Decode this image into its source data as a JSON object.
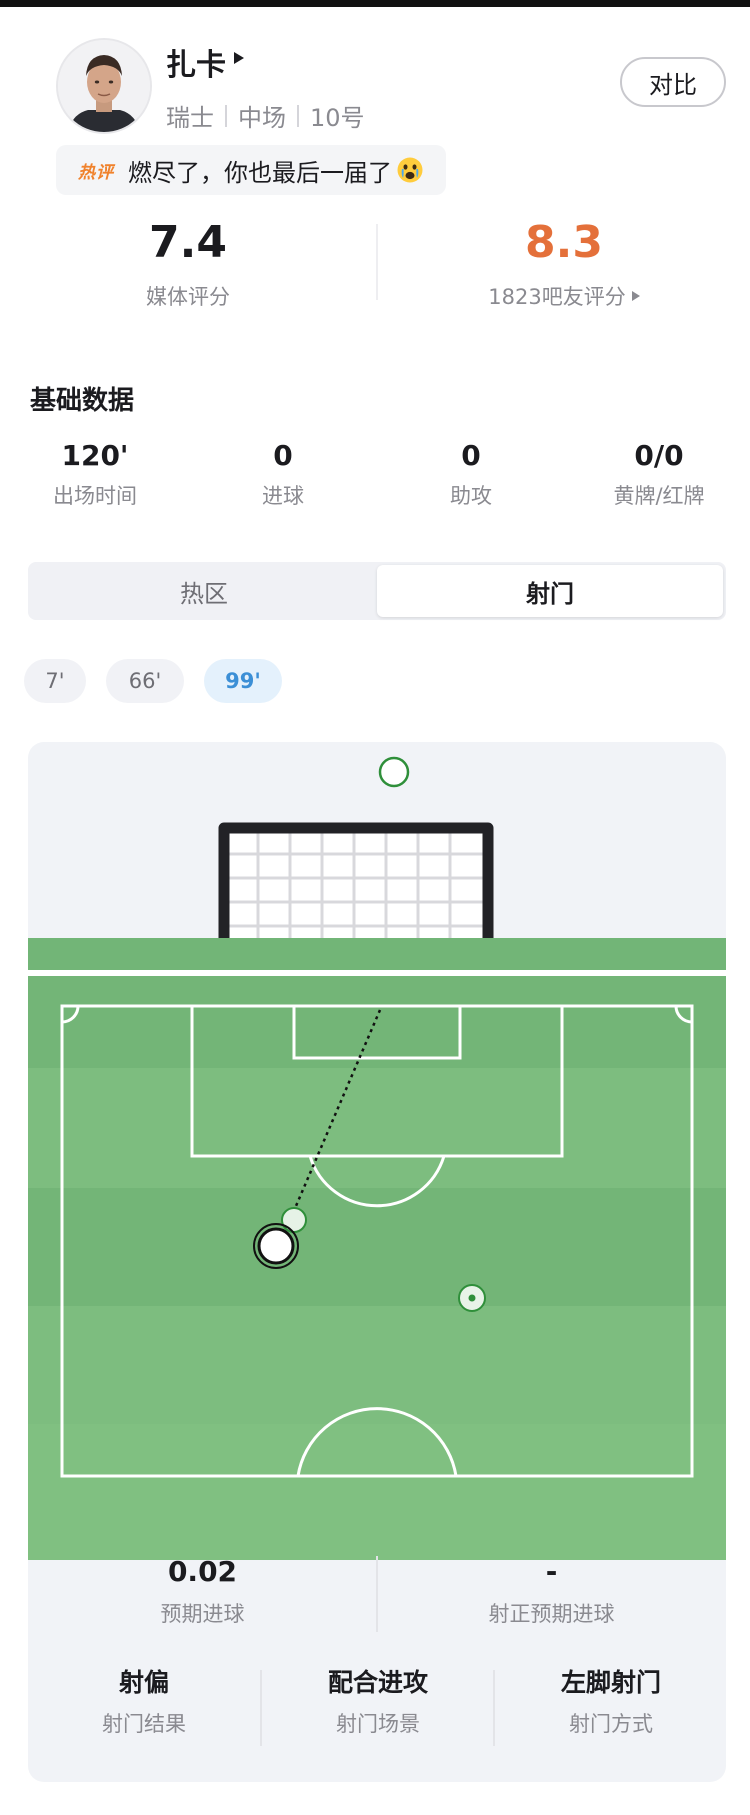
{
  "player": {
    "name": "扎卡",
    "country": "瑞士",
    "position": "中场",
    "number": "10号"
  },
  "compare_label": "对比",
  "hot_comment": {
    "tag": "热评",
    "text": "燃尽了，你也最后一届了"
  },
  "ratings": {
    "media_value": "7.4",
    "media_label": "媒体评分",
    "fan_value": "8.3",
    "fan_label": "1823吧友评分",
    "fan_color": "#e4703a"
  },
  "basic_stats": {
    "title": "基础数据",
    "items": [
      {
        "value": "120'",
        "label": "出场时间"
      },
      {
        "value": "0",
        "label": "进球"
      },
      {
        "value": "0",
        "label": "助攻"
      },
      {
        "value": "0/0",
        "label": "黄牌/红牌"
      }
    ]
  },
  "tabs": [
    {
      "label": "热区",
      "active": false
    },
    {
      "label": "射门",
      "active": true
    }
  ],
  "minute_chips": [
    {
      "label": "7'",
      "active": false
    },
    {
      "label": "66'",
      "active": false
    },
    {
      "label": "99'",
      "active": true
    }
  ],
  "shot_summary": {
    "xg_value": "0.02",
    "xg_label": "预期进球",
    "xgot_value": "-",
    "xgot_label": "射正预期进球",
    "details": [
      {
        "value": "射偏",
        "label": "射门结果"
      },
      {
        "value": "配合进攻",
        "label": "射门场景"
      },
      {
        "value": "左脚射门",
        "label": "射门方式"
      }
    ]
  },
  "colors": {
    "pitch_green": "#7dbd7f",
    "pitch_stripe": "#72b476",
    "chip_active": "#3b8fd6",
    "shot_outline": "#2f8f3a"
  },
  "icons": {
    "name_arrow": "caret-right-icon",
    "fan_arrow": "caret-right-icon",
    "emoji": "crying-face-icon"
  }
}
